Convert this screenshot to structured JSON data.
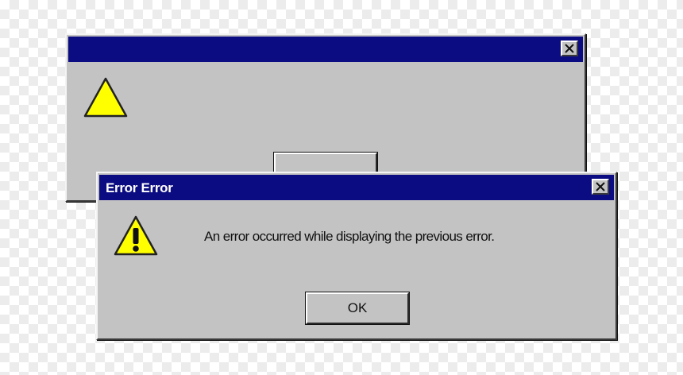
{
  "back_dialog": {
    "title": "",
    "icon": "warning-icon",
    "button_label": ""
  },
  "front_dialog": {
    "title": "Error Error",
    "icon": "warning-icon",
    "message": "An error occurred while displaying the previous error.",
    "ok_label": "OK"
  },
  "colors": {
    "titlebar": "#0c0c82",
    "dialog_face": "#c3c3c3",
    "warning_fill": "#ffff00"
  }
}
